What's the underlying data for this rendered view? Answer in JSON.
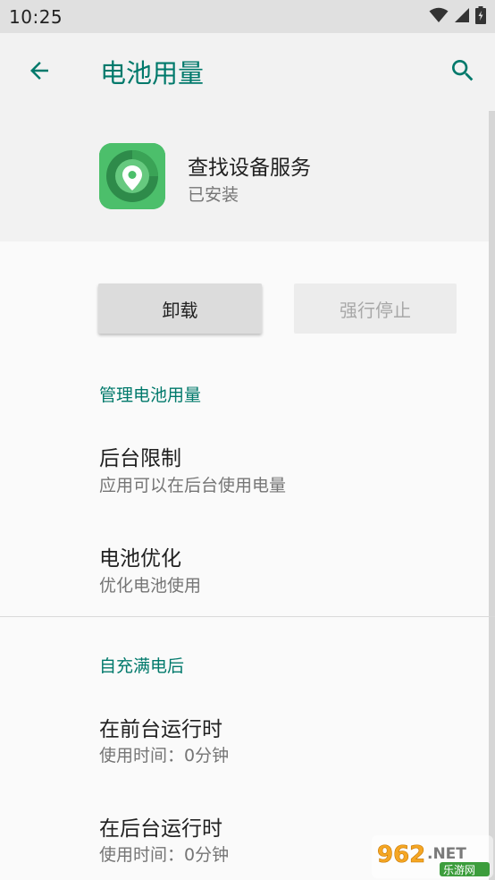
{
  "status_bar": {
    "time": "10:25",
    "icons": [
      "wifi-icon",
      "signal-icon",
      "battery-icon"
    ]
  },
  "app_bar": {
    "title": "电池用量",
    "back_icon": "arrow-back-icon",
    "search_icon": "search-icon"
  },
  "app_header": {
    "name": "查找设备服务",
    "status": "已安装",
    "icon": "location-pin-app-icon"
  },
  "buttons": {
    "uninstall": "卸载",
    "force_stop": "强行停止"
  },
  "section_manage": {
    "title": "管理电池用量",
    "items": [
      {
        "title": "后台限制",
        "subtitle": "应用可以在后台使用电量"
      },
      {
        "title": "电池优化",
        "subtitle": "优化电池使用"
      }
    ]
  },
  "section_since_charge": {
    "title": "自充满电后",
    "items": [
      {
        "title": "在前台运行时",
        "subtitle": "使用时间：0分钟"
      },
      {
        "title": "在后台运行时",
        "subtitle": "使用时间：0分钟"
      }
    ]
  },
  "watermark": {
    "brand": "962.NET",
    "caption": "乐游网"
  },
  "colors": {
    "accent": "#00796b",
    "app_icon_green": "#4cbf6b"
  }
}
